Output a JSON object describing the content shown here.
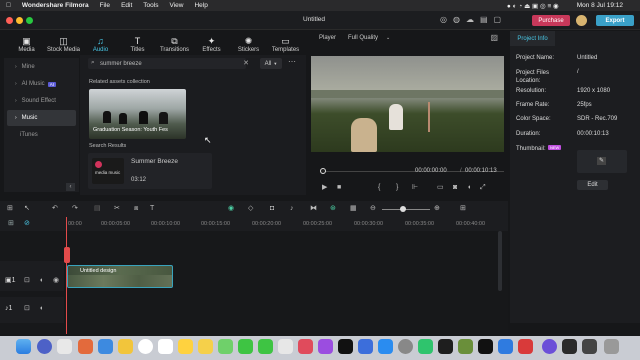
{
  "menubar": {
    "app": "Wondershare Filmora",
    "items": [
      "File",
      "Edit",
      "Tools",
      "View",
      "Help"
    ],
    "datetime": "Mon 8 Jul  19:12"
  },
  "window": {
    "title": "Untitled",
    "purchase": "Purchase",
    "export": "Export"
  },
  "tabs": [
    {
      "label": "Media",
      "icon": "media-icon"
    },
    {
      "label": "Stock Media",
      "icon": "stock-icon"
    },
    {
      "label": "Audio",
      "icon": "music-icon"
    },
    {
      "label": "Titles",
      "icon": "titles-icon"
    },
    {
      "label": "Transitions",
      "icon": "transition-icon"
    },
    {
      "label": "Effects",
      "icon": "effects-icon"
    },
    {
      "label": "Stickers",
      "icon": "sticker-icon"
    },
    {
      "label": "Templates",
      "icon": "templates-icon"
    }
  ],
  "nav": {
    "items": [
      "Mine",
      "AI Music",
      "Sound Effect",
      "Music",
      "iTunes"
    ],
    "ai_badge": "AI"
  },
  "assets": {
    "search_value": "summer breeze",
    "filter": "All",
    "related_title": "Related assets collection",
    "thumb_caption": "Graduation Season: Youth Fes",
    "search_results_title": "Search Results",
    "result": {
      "title": "Summer Breeze",
      "duration": "03:12",
      "source": "media music"
    }
  },
  "player": {
    "label": "Player",
    "quality": "Full Quality",
    "current": "00:00:00:00",
    "total": "00:00:10:13"
  },
  "project": {
    "title": "Project Info",
    "rows": [
      {
        "label": "Project Name:",
        "value": "Untitled"
      },
      {
        "label": "Project Files Location:",
        "value": "/"
      },
      {
        "label": "Resolution:",
        "value": "1920 x 1080"
      },
      {
        "label": "Frame Rate:",
        "value": "25fps"
      },
      {
        "label": "Color Space:",
        "value": "SDR - Rec.709"
      },
      {
        "label": "Duration:",
        "value": "00:00:10:13"
      }
    ],
    "thumbnail_label": "Thumbnail:",
    "new_badge": "NEW",
    "edit": "Edit"
  },
  "timeline": {
    "ticks": [
      "00:00",
      "00:00:05:00",
      "00:00:10:00",
      "00:00:15:00",
      "00:00:20:00",
      "00:00:25:00",
      "00:00:30:00",
      "00:00:35:00",
      "00:00:40:00"
    ],
    "clip_label": "Untitled design",
    "track_v": "1",
    "track_a": "1"
  }
}
